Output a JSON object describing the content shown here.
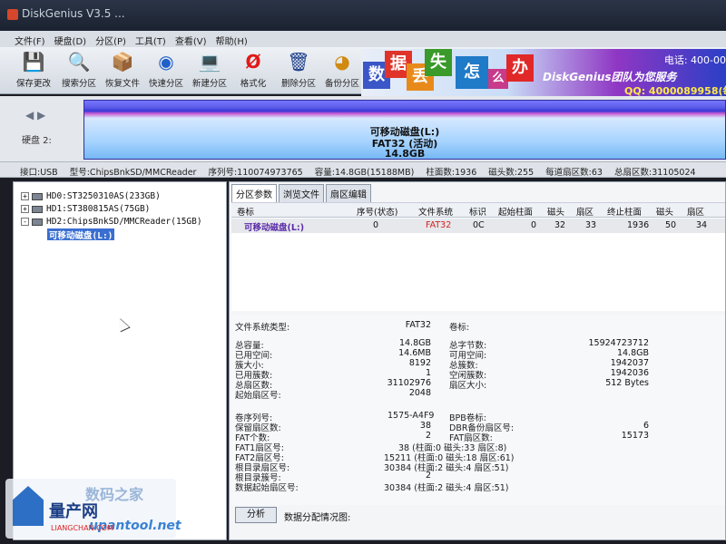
{
  "window": {
    "title": "DiskGenius V3.5 ..."
  },
  "menu": [
    "文件(F)",
    "硬盘(D)",
    "分区(P)",
    "工具(T)",
    "查看(V)",
    "帮助(H)"
  ],
  "toolbar": [
    {
      "label": "保存更改",
      "icon": "save-icon"
    },
    {
      "label": "搜索分区",
      "icon": "search-icon"
    },
    {
      "label": "恢复文件",
      "icon": "recover-file-icon"
    },
    {
      "label": "快速分区",
      "icon": "quick-partition-icon"
    },
    {
      "label": "新建分区",
      "icon": "new-partition-icon"
    },
    {
      "label": "格式化",
      "icon": "format-icon"
    },
    {
      "label": "删除分区",
      "icon": "delete-partition-icon"
    },
    {
      "label": "备份分区",
      "icon": "backup-partition-icon"
    }
  ],
  "banner": {
    "chars": [
      "数",
      "据",
      "丢",
      "失",
      "怎",
      "么",
      "办"
    ],
    "brand": "DiskGenius团队为您服务",
    "phone": "电话: 400-00",
    "qq": "QQ: 4000089958(每"
  },
  "disk_map": {
    "disk_label": "硬盘 2:",
    "partition_name": "可移动磁盘(L:)",
    "partition_fs": "FAT32 (活动)",
    "partition_size": "14.8GB"
  },
  "disk_info": {
    "interface": "接口:USB",
    "model": "型号:ChipsBnkSD/MMCReader",
    "serial": "序列号:110074973765",
    "capacity": "容量:14.8GB(15188MB)",
    "cylinders": "柱面数:1936",
    "heads": "磁头数:255",
    "sectors_per_track": "每道扇区数:63",
    "total_sectors": "总扇区数:31105024"
  },
  "tree": [
    {
      "label": "HD0:ST3250310AS(233GB)"
    },
    {
      "label": "HD1:ST380815AS(75GB)"
    },
    {
      "label": "HD2:ChipsBnkSD/MMCReader(15GB)"
    }
  ],
  "tree_selected": "可移动磁盘(L:)",
  "tabs": [
    "分区参数",
    "浏览文件",
    "扇区编辑"
  ],
  "partition_table": {
    "headers": [
      "卷标",
      "序号(状态)",
      "文件系统",
      "标识",
      "起始柱面",
      "磁头",
      "扇区",
      "终止柱面",
      "磁头",
      "扇区"
    ],
    "row": [
      "可移动磁盘(L:)",
      "0",
      "FAT32",
      "0C",
      "0",
      "32",
      "33",
      "1936",
      "50",
      "34"
    ]
  },
  "fs_details": {
    "fs_type_label": "文件系统类型:",
    "fs_type": "FAT32",
    "volume_label_label": "卷标:",
    "volume_label": "",
    "left1": [
      {
        "k": "总容量:",
        "v": "14.8GB"
      },
      {
        "k": "已用空间:",
        "v": "14.6MB"
      },
      {
        "k": "簇大小:",
        "v": "8192"
      },
      {
        "k": "已用簇数:",
        "v": "1"
      },
      {
        "k": "总扇区数:",
        "v": "31102976"
      },
      {
        "k": "起始扇区号:",
        "v": "2048"
      }
    ],
    "right1": [
      {
        "k": "总字节数:",
        "v": "15924723712"
      },
      {
        "k": "可用空间:",
        "v": "14.8GB"
      },
      {
        "k": "总簇数:",
        "v": "1942037"
      },
      {
        "k": "空闲簇数:",
        "v": "1942036"
      },
      {
        "k": "扇区大小:",
        "v": "512 Bytes"
      }
    ],
    "left2": [
      {
        "k": "卷序列号:",
        "v": "1575-A4F9"
      },
      {
        "k": "保留扇区数:",
        "v": "38"
      },
      {
        "k": "FAT个数:",
        "v": "2"
      },
      {
        "k": "FAT1扇区号:",
        "v": "38 (柱面:0 磁头:33 扇区:8)"
      },
      {
        "k": "FAT2扇区号:",
        "v": "15211 (柱面:0 磁头:18 扇区:61)"
      },
      {
        "k": "根目录扇区号:",
        "v": "30384 (柱面:2 磁头:4 扇区:51)"
      },
      {
        "k": "根目录簇号:",
        "v": "2"
      },
      {
        "k": "数据起始扇区号:",
        "v": "30384 (柱面:2 磁头:4 扇区:51)"
      }
    ],
    "right2": [
      {
        "k": "BPB卷标:",
        "v": ""
      },
      {
        "k": "DBR备份扇区号:",
        "v": "6"
      },
      {
        "k": "FAT扇区数:",
        "v": "15173"
      }
    ]
  },
  "bottom": {
    "analyze_button": "分析",
    "allocation_label": "数据分配情况图:"
  },
  "watermark": {
    "line1": "数码之家",
    "line2": "量产网",
    "line3": "upantool.net",
    "line4": "LIANGCHAN.COM"
  },
  "colors": {
    "accent": "#3a6ed0",
    "partition_blue": "#3838d8",
    "fat32_red": "#d42020"
  }
}
